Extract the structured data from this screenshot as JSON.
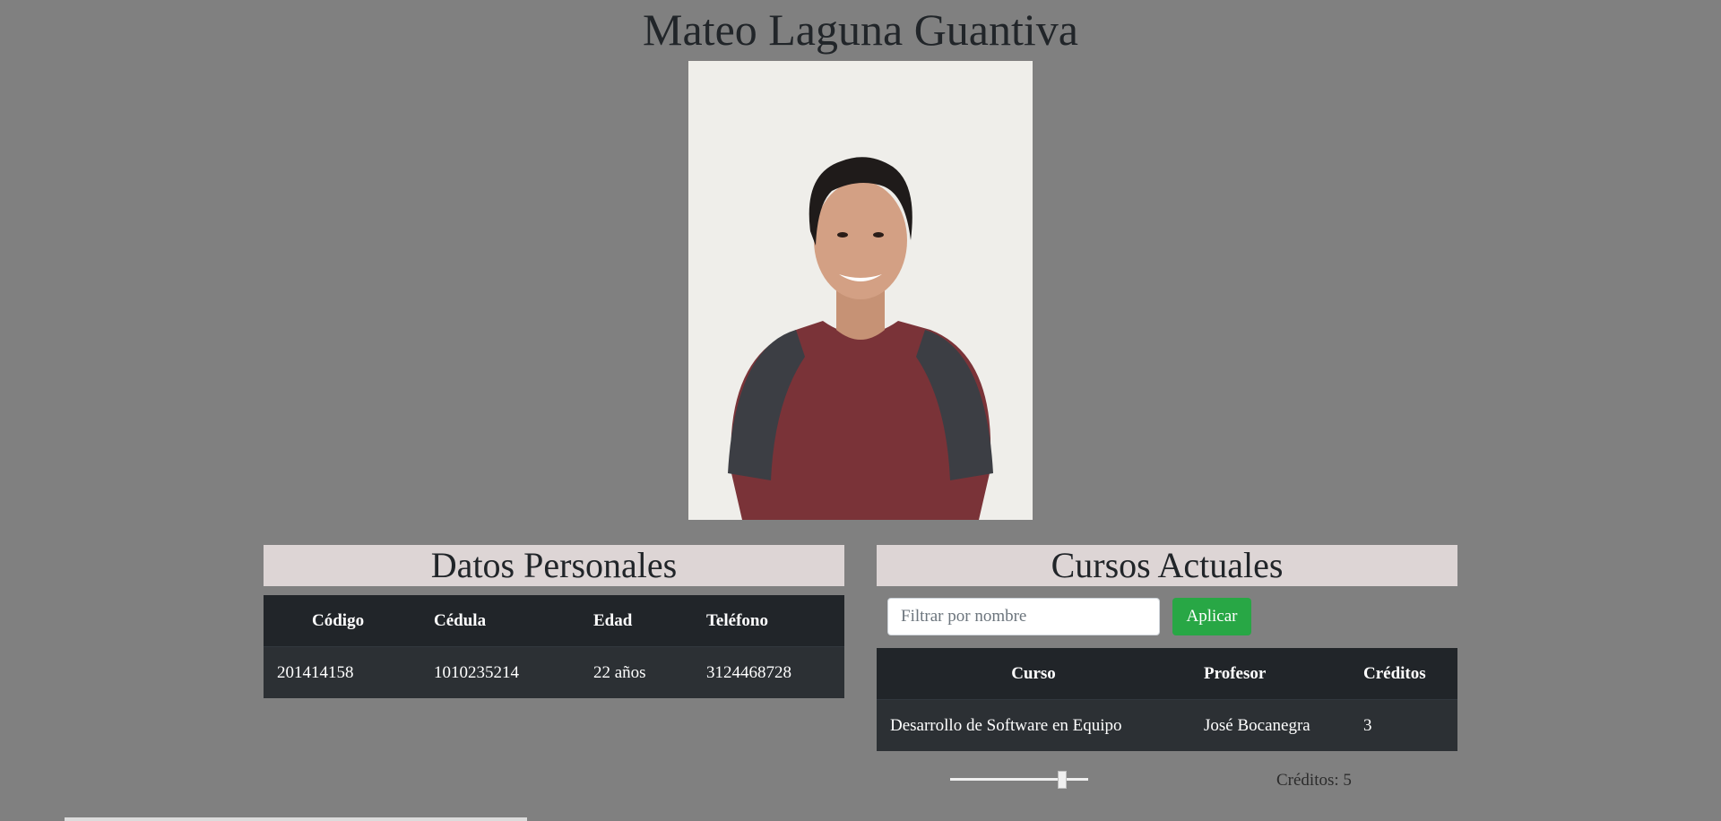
{
  "header": {
    "title": "Mateo Laguna Guantiva"
  },
  "photo": {
    "alt": "Foto de perfil"
  },
  "personal": {
    "title": "Datos Personales",
    "columns": [
      "Código",
      "Cédula",
      "Edad",
      "Teléfono"
    ],
    "row": [
      "201414158",
      "1010235214",
      "22 años",
      "3124468728"
    ]
  },
  "courses": {
    "title": "Cursos Actuales",
    "filter": {
      "placeholder": "Filtrar por nombre",
      "value": ""
    },
    "apply_label": "Aplicar",
    "columns": [
      "Curso",
      "Profesor",
      "Créditos"
    ],
    "rows": [
      [
        "Desarrollo de Software en Equipo",
        "José Bocanegra",
        "3"
      ]
    ],
    "slider": {
      "value": 5,
      "min": 0,
      "max": 6
    },
    "credits_label": "Créditos: 5"
  },
  "colors": {
    "background": "#808080",
    "table_header": "#212529",
    "table_row": "#2c3034",
    "section_header": "#ddd5d5",
    "button": "#28a745"
  }
}
